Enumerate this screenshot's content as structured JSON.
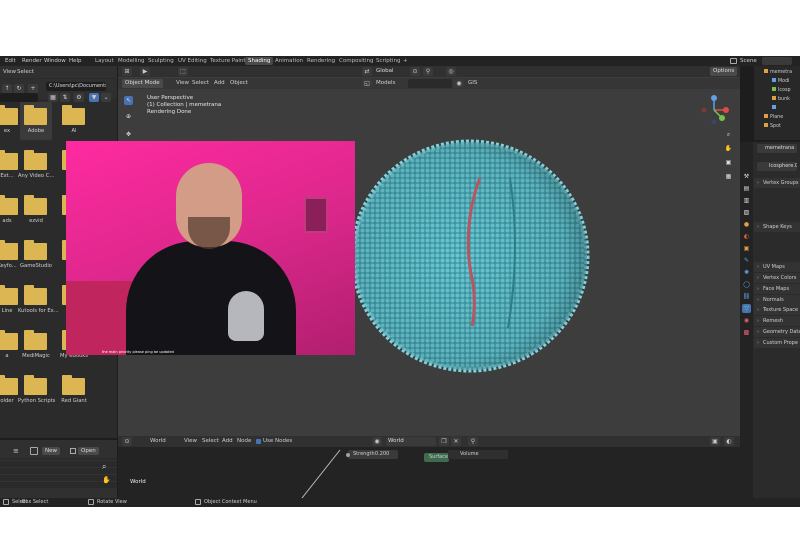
{
  "topmenu": [
    "Edit",
    "Render",
    "Window",
    "Help"
  ],
  "workspaces": [
    "Layout",
    "Modelling",
    "Sculpting",
    "UV Editing",
    "Texture Paint",
    "Shading",
    "Animation",
    "Rendering",
    "Compositing",
    "Scripting"
  ],
  "active_workspace": "Shading",
  "add_workspace": "+",
  "scene": {
    "label": "Scene"
  },
  "file_browser": {
    "menu": [
      "View",
      "Select"
    ],
    "path": "C:\\Users\\pc\\Documents\\",
    "folders": [
      [
        "ex",
        "Adobe",
        "Al"
      ],
      [
        "Ext...",
        "Any Video C...",
        ""
      ],
      [
        "ads",
        "ezvid",
        ""
      ],
      [
        "Keyfo...",
        "GameStudio",
        ""
      ],
      [
        "Line",
        "Kutools for Ex...",
        "m"
      ],
      [
        "a",
        "MediMagic",
        "My eBooks"
      ],
      [
        "older",
        "Python Scripts",
        "Red Giant"
      ]
    ],
    "new_label": "New",
    "open_label": "Open"
  },
  "viewport": {
    "mode": "Object Mode",
    "menu": [
      "View",
      "Select",
      "Add",
      "Object"
    ],
    "orientation": "Global",
    "overlay_lines": [
      "User Perspective",
      "(1) Collection | memetrana",
      "Rendering Done"
    ],
    "options": "Options",
    "models": "Models",
    "gis": "GIS"
  },
  "webcam": {
    "caption": "the main priority please ping be updated"
  },
  "node_editor": {
    "world_select": "World",
    "menu": [
      "View",
      "Select",
      "Add",
      "Node"
    ],
    "use_nodes": "Use Nodes",
    "world_name": "World",
    "strength_label": "Strength",
    "strength_value": "0.200",
    "node_label": "Surface",
    "volume_label": "Volume",
    "world_text": "World"
  },
  "outliner": {
    "items": [
      "memetra",
      "Modi",
      "Icosp",
      "bunk",
      "",
      "Plane",
      "Spot"
    ]
  },
  "properties": {
    "object": "memetrana",
    "mesh": "Icosphere.0",
    "sections": [
      "Vertex Groups",
      "Shape Keys",
      "UV Maps",
      "Vertex Colors",
      "Face Maps",
      "Normals",
      "Texture Space",
      "Remesh",
      "Geometry Data",
      "Custom Prope"
    ]
  },
  "statusbar": {
    "items": [
      "Select",
      "Box Select",
      "Rotate View",
      "Object Context Menu"
    ]
  },
  "colors": {
    "accent": "#4772b3",
    "sphere": "#5fc3cf",
    "webcam_bg": "#e0328f",
    "folder": "#dcb653"
  }
}
